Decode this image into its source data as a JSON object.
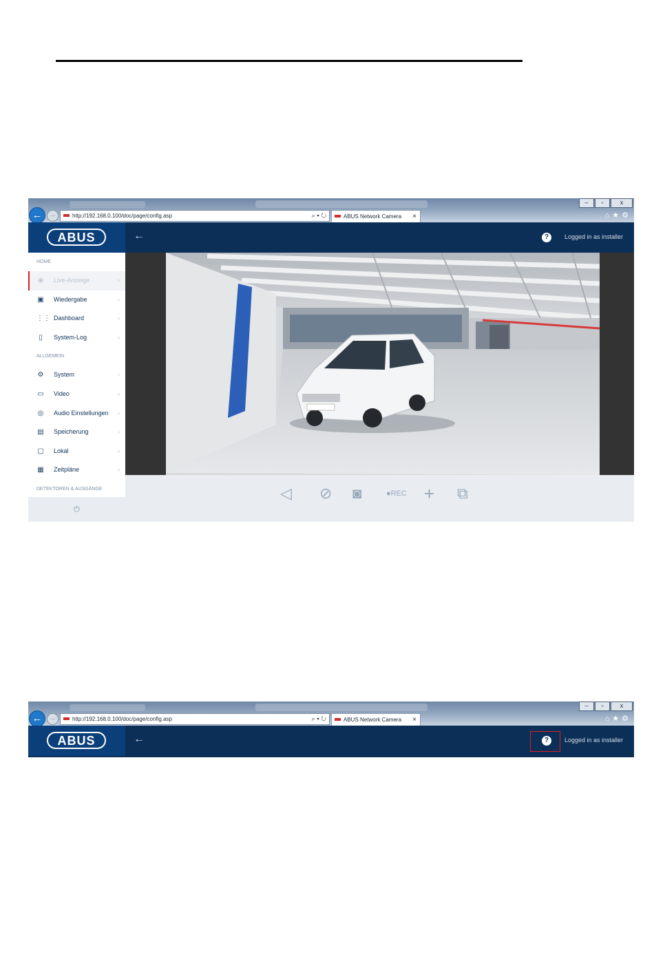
{
  "browser": {
    "url": "http://192.168.0.100/doc/page/config.asp",
    "tab_title": "ABUS Network Camera",
    "address_tools": "⌕ ▾ ↻",
    "tab_close": "×",
    "window_buttons": [
      "–",
      "▫",
      "x"
    ],
    "toolbar_icons": [
      "home-icon",
      "star-icon",
      "gear-icon"
    ]
  },
  "app": {
    "logo": "ABUS",
    "logged_in": "Logged in as installer",
    "help_label": "?"
  },
  "sidebar": {
    "sections": [
      {
        "title": "HOME",
        "items": [
          {
            "label": "Live-Anzeige",
            "icon": "eye-icon",
            "active": true
          },
          {
            "label": "Wiedergabe",
            "icon": "playback-icon"
          },
          {
            "label": "Dashboard",
            "icon": "dashboard-icon"
          },
          {
            "label": "System-Log",
            "icon": "log-icon"
          }
        ]
      },
      {
        "title": "ALLGEMEIN",
        "items": [
          {
            "label": "System",
            "icon": "gear-icon"
          },
          {
            "label": "Video",
            "icon": "video-icon"
          },
          {
            "label": "Audio Einstellungen",
            "icon": "audio-icon"
          },
          {
            "label": "Speicherung",
            "icon": "storage-icon"
          },
          {
            "label": "Lokal",
            "icon": "local-icon"
          },
          {
            "label": "Zeitpläne",
            "icon": "calendar-icon"
          }
        ]
      },
      {
        "title": "DETEKTOREN & AUSGÄNGE",
        "items": []
      }
    ]
  },
  "controls": {
    "rec_label": "REC",
    "icons": [
      "speaker-icon",
      "mic-muted-icon",
      "snapshot-icon",
      "record-icon",
      "zoom-plus-icon",
      "fullscreen-icon"
    ]
  },
  "colors": {
    "header": "#0c2f57",
    "logo_bg": "#0b3f7a",
    "active_marker": "#d8202a",
    "highlight_box": "#e02020"
  }
}
